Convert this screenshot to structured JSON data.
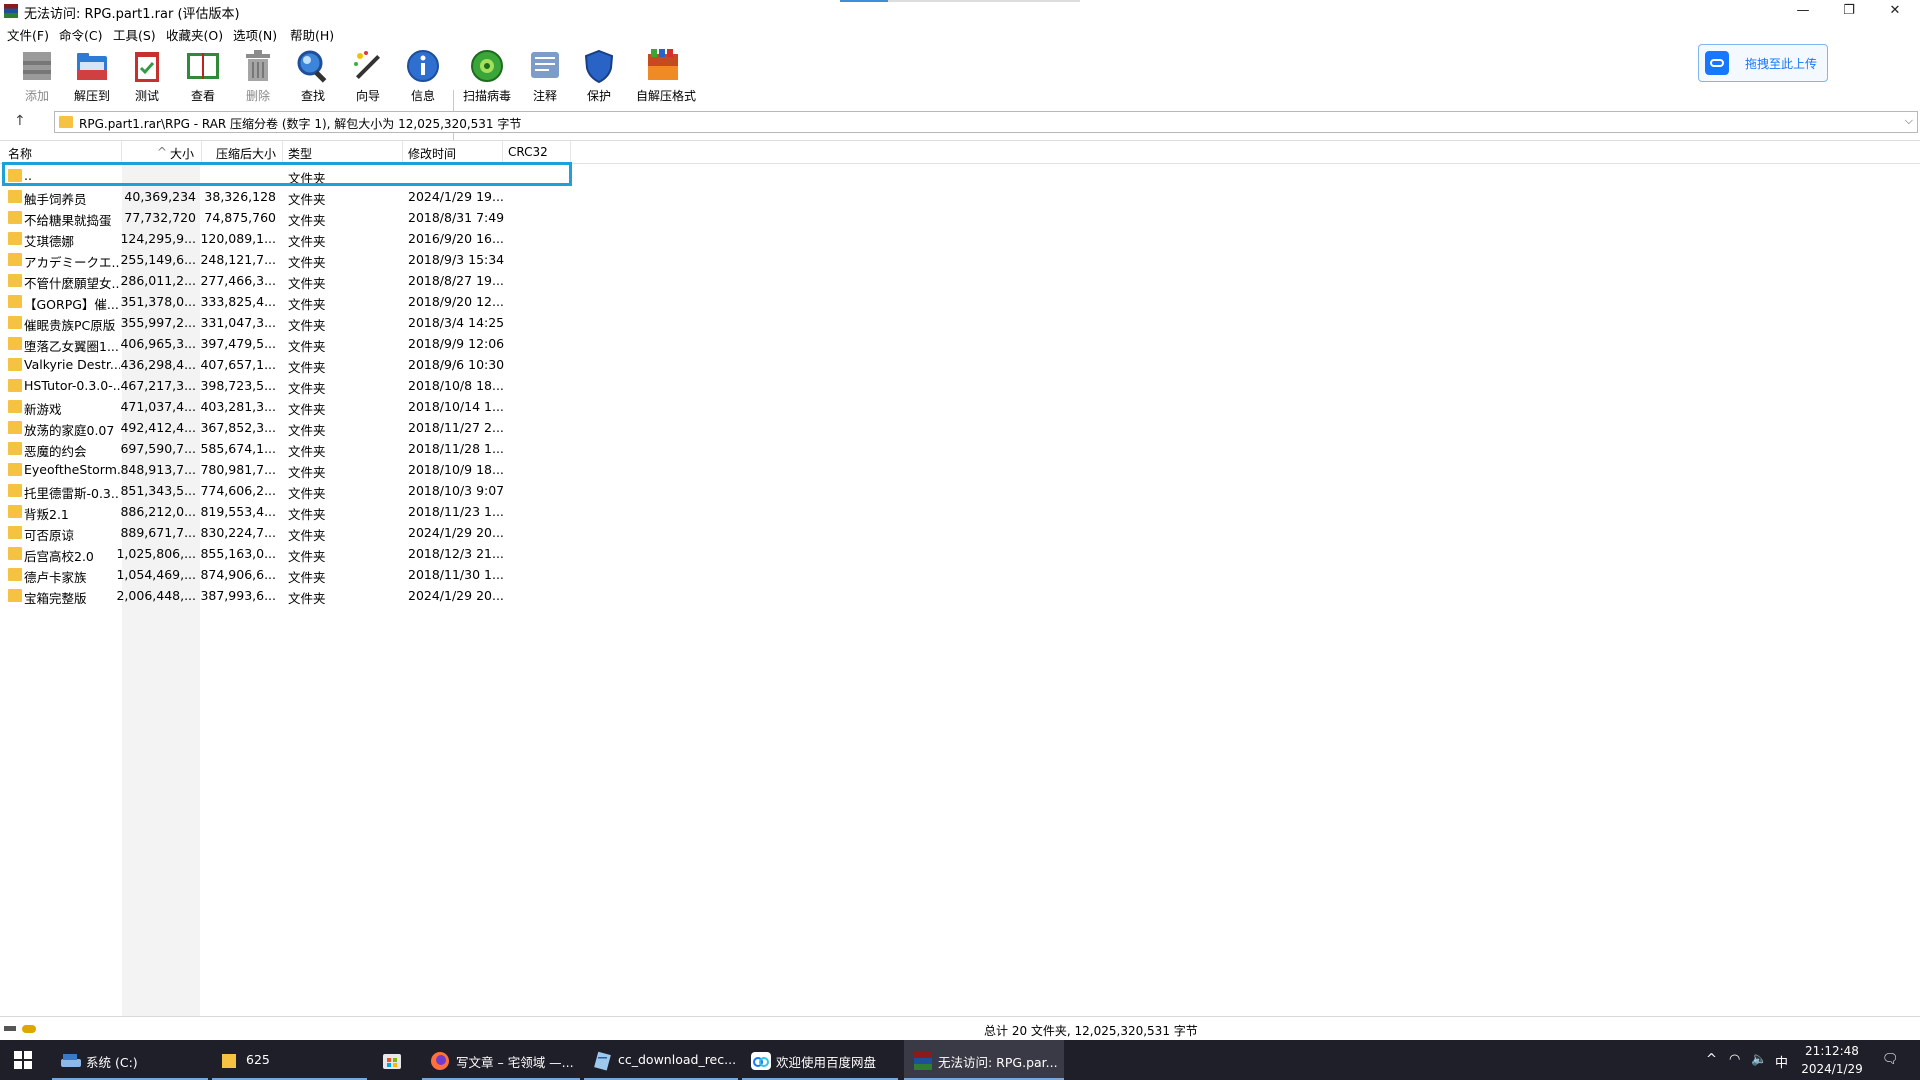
{
  "window": {
    "title": "无法访问: RPG.part1.rar (评估版本)",
    "controls": {
      "minimize": "—",
      "restore": "❐",
      "close": "✕"
    }
  },
  "menu": [
    "文件(F)",
    "命令(C)",
    "工具(S)",
    "收藏夹(O)",
    "选项(N)",
    "帮助(H)"
  ],
  "toolbar": {
    "buttons": [
      {
        "label": "添加",
        "icon": "add-archive-icon",
        "disabled": true
      },
      {
        "label": "解压到",
        "icon": "extract-folder-icon",
        "disabled": false
      },
      {
        "label": "测试",
        "icon": "test-clipboard-icon",
        "disabled": false
      },
      {
        "label": "查看",
        "icon": "view-book-icon",
        "disabled": false
      },
      {
        "label": "删除",
        "icon": "trash-icon",
        "disabled": true
      },
      {
        "label": "查找",
        "icon": "magnifier-icon",
        "disabled": false
      },
      {
        "label": "向导",
        "icon": "magic-wand-icon",
        "disabled": false
      },
      {
        "label": "信息",
        "icon": "info-icon",
        "disabled": false
      },
      {
        "label": "扫描病毒",
        "icon": "virus-scan-icon",
        "disabled": false
      },
      {
        "label": "注释",
        "icon": "comment-icon",
        "disabled": false
      },
      {
        "label": "保护",
        "icon": "shield-icon",
        "disabled": false
      },
      {
        "label": "自解压格式",
        "icon": "sfx-archive-icon",
        "disabled": false
      }
    ],
    "upload_label": "拖拽至此上传"
  },
  "address": {
    "up_glyph": "↑",
    "path": "RPG.part1.rar\\RPG - RAR 压缩分卷 (数字 1), 解包大小为 12,025,320,531 字节",
    "dropdown_glyph": "⌵"
  },
  "columns": {
    "name": "名称",
    "size": "大小",
    "packed": "压缩后大小",
    "type": "类型",
    "modified": "修改时间",
    "crc": "CRC32",
    "sort_glyph": "^"
  },
  "rows": [
    {
      "name": "..",
      "size": "",
      "packed": "",
      "type": "文件夹",
      "modified": ""
    },
    {
      "name": "触手饲养员",
      "size": "40,369,234",
      "packed": "38,326,128",
      "type": "文件夹",
      "modified": "2024/1/29 19..."
    },
    {
      "name": "不给糖果就捣蛋",
      "size": "77,732,720",
      "packed": "74,875,760",
      "type": "文件夹",
      "modified": "2018/8/31 7:49"
    },
    {
      "name": "艾琪德娜",
      "size": "124,295,9...",
      "packed": "120,089,1...",
      "type": "文件夹",
      "modified": "2016/9/20 16..."
    },
    {
      "name": "アカデミークエ...",
      "size": "255,149,6...",
      "packed": "248,121,7...",
      "type": "文件夹",
      "modified": "2018/9/3 15:34"
    },
    {
      "name": "不管什麼願望女...",
      "size": "286,011,2...",
      "packed": "277,466,3...",
      "type": "文件夹",
      "modified": "2018/8/27 19..."
    },
    {
      "name": "【GORPG】催...",
      "size": "351,378,0...",
      "packed": "333,825,4...",
      "type": "文件夹",
      "modified": "2018/9/20 12..."
    },
    {
      "name": "催眠贵族PC原版",
      "size": "355,997,2...",
      "packed": "331,047,3...",
      "type": "文件夹",
      "modified": "2018/3/4 14:25"
    },
    {
      "name": "堕落乙女翼圈1....",
      "size": "406,965,3...",
      "packed": "397,479,5...",
      "type": "文件夹",
      "modified": "2018/9/9 12:06"
    },
    {
      "name": "Valkyrie Destr...",
      "size": "436,298,4...",
      "packed": "407,657,1...",
      "type": "文件夹",
      "modified": "2018/9/6 10:30"
    },
    {
      "name": "HSTutor-0.3.0-...",
      "size": "467,217,3...",
      "packed": "398,723,5...",
      "type": "文件夹",
      "modified": "2018/10/8 18..."
    },
    {
      "name": "新游戏",
      "size": "471,037,4...",
      "packed": "403,281,3...",
      "type": "文件夹",
      "modified": "2018/10/14 1..."
    },
    {
      "name": "放荡的家庭0.07",
      "size": "492,412,4...",
      "packed": "367,852,3...",
      "type": "文件夹",
      "modified": "2018/11/27 2..."
    },
    {
      "name": "恶魔的约会",
      "size": "697,590,7...",
      "packed": "585,674,1...",
      "type": "文件夹",
      "modified": "2018/11/28 1..."
    },
    {
      "name": "EyeoftheStorm...",
      "size": "848,913,7...",
      "packed": "780,981,7...",
      "type": "文件夹",
      "modified": "2018/10/9 18..."
    },
    {
      "name": "托里德雷斯-0.3....",
      "size": "851,343,5...",
      "packed": "774,606,2...",
      "type": "文件夹",
      "modified": "2018/10/3 9:07"
    },
    {
      "name": "背叛2.1",
      "size": "886,212,0...",
      "packed": "819,553,4...",
      "type": "文件夹",
      "modified": "2018/11/23 1..."
    },
    {
      "name": "可否原谅",
      "size": "889,671,7...",
      "packed": "830,224,7...",
      "type": "文件夹",
      "modified": "2024/1/29 20..."
    },
    {
      "name": "后宫高校2.0",
      "size": "1,025,806,...",
      "packed": "855,163,0...",
      "type": "文件夹",
      "modified": "2018/12/3 21..."
    },
    {
      "name": "德卢卡家族",
      "size": "1,054,469,...",
      "packed": "874,906,6...",
      "type": "文件夹",
      "modified": "2018/11/30 1..."
    },
    {
      "name": "宝箱完整版",
      "size": "2,006,448,...",
      "packed": "387,993,6...",
      "type": "文件夹",
      "modified": "2024/1/29 20..."
    }
  ],
  "status": {
    "text": "总计 20 文件夹, 12,025,320,531 字节"
  },
  "taskbar": {
    "items": [
      {
        "label": "系统 (C:)",
        "icon": "drive-icon"
      },
      {
        "label": "625",
        "icon": "folder-icon"
      },
      {
        "label": "",
        "icon": "store-icon"
      },
      {
        "label": "写文章 – 宅领域 —...",
        "icon": "firefox-icon"
      },
      {
        "label": "cc_download_rec...",
        "icon": "notepad-icon"
      },
      {
        "label": "欢迎使用百度网盘",
        "icon": "baidu-netdisk-icon"
      },
      {
        "label": "无法访问: RPG.par...",
        "icon": "winrar-icon"
      }
    ],
    "tray": {
      "chevron": "^",
      "network": "◠",
      "volume": "🔈",
      "ime": "中",
      "notification": "🗨"
    },
    "clock": {
      "time": "21:12:48",
      "date": "2024/1/29"
    }
  }
}
